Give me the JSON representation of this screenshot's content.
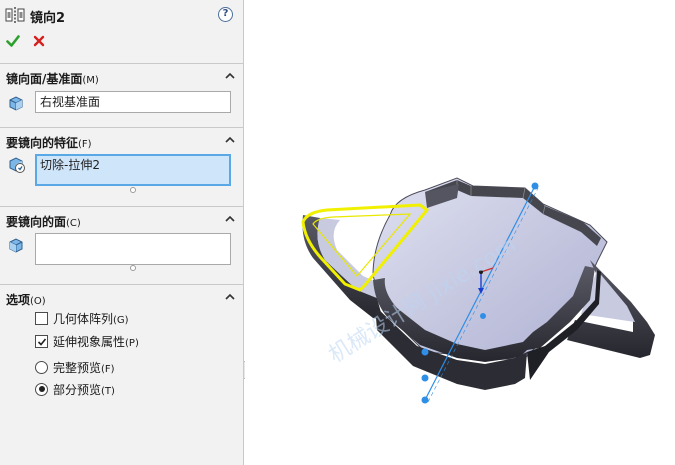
{
  "feature": {
    "title": "镜向2",
    "help_symbol": "?"
  },
  "sections": {
    "mirror_plane": {
      "title": "镜向面/基准面",
      "shortcut": "(M)",
      "value": "右视基准面"
    },
    "features_to_mirror": {
      "title": "要镜向的特征",
      "shortcut": "(F)",
      "value": "切除-拉伸2"
    },
    "faces_to_mirror": {
      "title": "要镜向的面",
      "shortcut": "(C)",
      "value": ""
    },
    "options": {
      "title": "选项",
      "shortcut": "(O)",
      "geometry_pattern": {
        "label": "几何体阵列",
        "shortcut": "(G)",
        "checked": false
      },
      "propagate_visual": {
        "label": "延伸视象属性",
        "shortcut": "(P)",
        "checked": true
      },
      "full_preview": {
        "label": "完整预览",
        "shortcut": "(F)",
        "selected": false
      },
      "partial_preview": {
        "label": "部分预览",
        "shortcut": "(T)",
        "selected": true
      }
    }
  },
  "viewport": {
    "watermark": "机械设计网 jixie.com"
  },
  "colors": {
    "accent_blue": "#2f8ee6",
    "selection_yellow": "#f0f000",
    "ok_green": "#2ca02c",
    "cancel_red": "#d62020",
    "part_dark": "#3b3b44",
    "part_face": "#c9cbe3"
  }
}
